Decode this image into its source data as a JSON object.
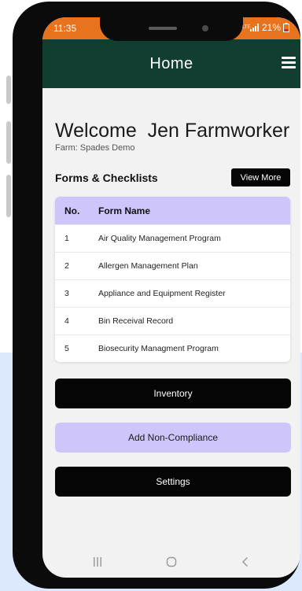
{
  "status_bar": {
    "time": "11:35",
    "network": "VoLTE",
    "battery": "21%",
    "color": "#e8731f"
  },
  "app_bar": {
    "title": "Home",
    "menu_icon": "hamburger-menu-icon",
    "color": "#123e32"
  },
  "welcome": {
    "greeting": "Welcome  Jen Farmworker",
    "farm": "Farm: Spades Demo"
  },
  "forms": {
    "section_title": "Forms & Checklists",
    "view_more_label": "View More",
    "columns": [
      "No.",
      "Form Name"
    ],
    "rows": [
      {
        "no": "1",
        "name": "Air Quality Management Program"
      },
      {
        "no": "2",
        "name": "Allergen Management Plan"
      },
      {
        "no": "3",
        "name": "Appliance and Equipment Register"
      },
      {
        "no": "4",
        "name": "Bin Receival Record"
      },
      {
        "no": "5",
        "name": "Biosecurity Managment Program"
      }
    ],
    "header_color": "#cec5fb"
  },
  "actions": {
    "inventory_label": "Inventory",
    "non_compliance_label": "Add Non-Compliance",
    "settings_label": "Settings"
  },
  "nav_bar": {
    "icons": [
      "recents-icon",
      "home-icon",
      "back-icon"
    ]
  }
}
